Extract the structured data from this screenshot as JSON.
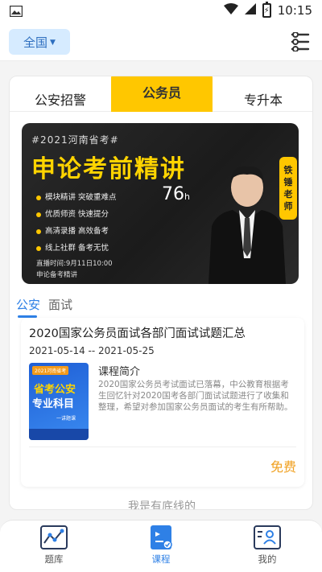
{
  "status_bar": {
    "time": "10:15"
  },
  "header": {
    "region_label": "全国"
  },
  "tabs": [
    {
      "label": "公安招警"
    },
    {
      "label": "公务员"
    },
    {
      "label": "专升本"
    }
  ],
  "banner": {
    "top_text": "#2021河南省考#",
    "title": "申论考前精讲",
    "features": [
      "模块精讲  突破重难点",
      "优质师资  快速提分",
      "高清录播  高效备考",
      "线上社群  备考无忧"
    ],
    "hours_value": "76",
    "hours_unit": "h",
    "live_time": "直播时间:9月11日10:00",
    "footer_label": "申论备考精讲",
    "teacher_label": [
      "铁",
      "锤",
      "老",
      "师"
    ]
  },
  "subtabs": [
    {
      "label": "公安"
    },
    {
      "label": "面试"
    }
  ],
  "course": {
    "title": "2020国家公务员面试各部门面试试题汇总",
    "date_range": "2021-05-14 -- 2021-05-25",
    "intro_label": "课程简介",
    "intro_text": "2020国家公务员考试面试已落幕，中公教育根据考生回忆针对2020国考各部门面试试题进行了收集和整理，希望对参加国家公务员面试的考生有所帮助。",
    "price": "免费",
    "cover": {
      "badge": "2021河南省考",
      "line1": "省考公安",
      "line2": "专业科目",
      "line3": "一讲题课"
    }
  },
  "end_text": "我是有底线的",
  "bottom_nav": [
    {
      "label": "题库",
      "icon": "chart-icon"
    },
    {
      "label": "课程",
      "icon": "course-icon"
    },
    {
      "label": "我的",
      "icon": "profile-icon"
    }
  ],
  "colors": {
    "accent": "#2e80e6",
    "tab_active": "#ffc700",
    "price": "#f0a020"
  }
}
